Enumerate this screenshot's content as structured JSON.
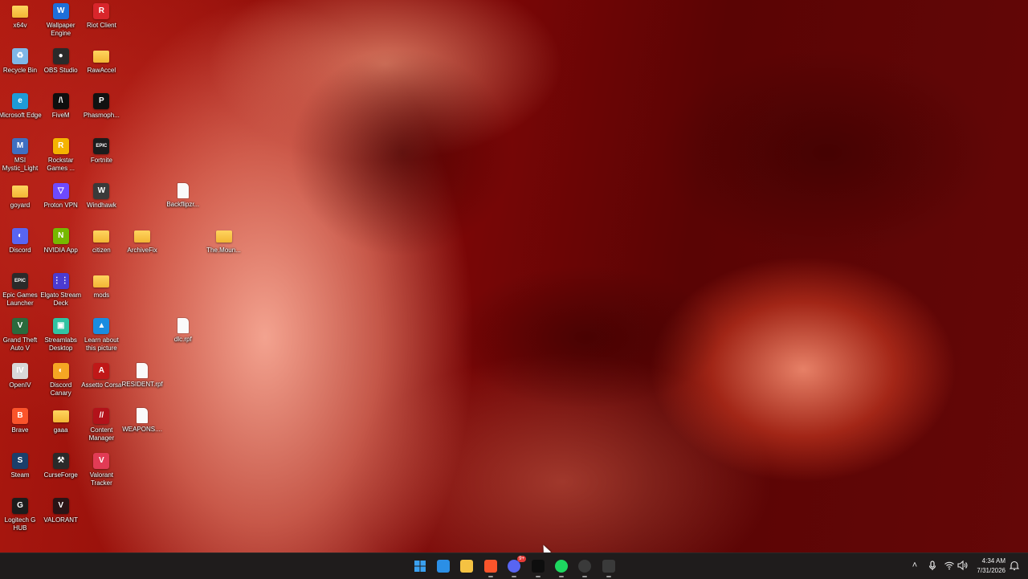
{
  "desktop": {
    "icons": [
      {
        "label": "x64v",
        "icon": "folder-icon"
      },
      {
        "label": "Wallpaper Engine",
        "icon": "wallpaper-engine-icon",
        "color": "#1e6fd9",
        "glyph": "W"
      },
      {
        "label": "Riot Client",
        "icon": "riot-client-icon",
        "color": "#d9262b",
        "glyph": "R"
      },
      {
        "label": "Recycle Bin",
        "icon": "recycle-bin-icon",
        "color": "#7fb7e8",
        "glyph": "♻"
      },
      {
        "label": "OBS Studio",
        "icon": "obs-studio-icon",
        "color": "#2a2a2a",
        "glyph": "●"
      },
      {
        "label": "RawAccel",
        "icon": "folder-icon"
      },
      {
        "label": "Microsoft Edge",
        "icon": "edge-icon",
        "color": "#1f9bd6",
        "glyph": "e"
      },
      {
        "label": "FiveM",
        "icon": "fivem-icon",
        "color": "#0e0e0e",
        "glyph": "/\\"
      },
      {
        "label": "Phasmoph...",
        "icon": "phasmophobia-icon",
        "color": "#111111",
        "glyph": "P"
      },
      {
        "label": "MSI Mystic_Light",
        "icon": "msi-mystic-light-icon",
        "color": "#3f6fc2",
        "glyph": "M"
      },
      {
        "label": "Rockstar Games ...",
        "icon": "rockstar-games-icon",
        "color": "#f5b400",
        "glyph": "R"
      },
      {
        "label": "Fortnite",
        "icon": "fortnite-icon",
        "color": "#1c1c1c",
        "glyph": "EPIC"
      },
      {
        "label": "goyard",
        "icon": "folder-icon"
      },
      {
        "label": "Proton VPN",
        "icon": "proton-vpn-icon",
        "color": "#6d4aff",
        "glyph": "▽"
      },
      {
        "label": "Windhawk",
        "icon": "windhawk-icon",
        "color": "#3a3a3a",
        "glyph": "W"
      },
      {
        "label": "Backflipzr...",
        "icon": "file-icon"
      },
      {
        "label": "Discord",
        "icon": "discord-icon",
        "color": "#5865f2",
        "glyph": "◐"
      },
      {
        "label": "NVIDIA App",
        "icon": "nvidia-app-icon",
        "color": "#76b900",
        "glyph": "N"
      },
      {
        "label": "citizen",
        "icon": "folder-icon"
      },
      {
        "label": "ArchiveFix",
        "icon": "folder-icon"
      },
      {
        "label": "The.Moun...",
        "icon": "archive-folder-icon"
      },
      {
        "label": "Epic Games Launcher",
        "icon": "epic-games-icon",
        "color": "#2a2a2a",
        "glyph": "EPIC"
      },
      {
        "label": "Elgato Stream Deck",
        "icon": "stream-deck-icon",
        "color": "#4b3bd1",
        "glyph": "⋮⋮"
      },
      {
        "label": "mods",
        "icon": "folder-icon"
      },
      {
        "label": "Grand Theft Auto V",
        "icon": "gta-v-icon",
        "color": "#2b6a3d",
        "glyph": "V"
      },
      {
        "label": "Streamlabs Desktop",
        "icon": "streamlabs-icon",
        "color": "#31c3a2",
        "glyph": "▣"
      },
      {
        "label": "Learn about this picture",
        "icon": "learn-about-picture-icon",
        "color": "#1a8ce0",
        "glyph": "▲"
      },
      {
        "label": "dlc.rpf",
        "icon": "file-icon"
      },
      {
        "label": "OpenIV",
        "icon": "openiv-icon",
        "color": "#d8d8d8",
        "glyph": "IV"
      },
      {
        "label": "Discord Canary",
        "icon": "discord-canary-icon",
        "color": "#f5a623",
        "glyph": "◐"
      },
      {
        "label": "Assetto Corsa",
        "icon": "assetto-corsa-icon",
        "color": "#c01818",
        "glyph": "A"
      },
      {
        "label": "RESIDENT.rpf",
        "icon": "file-icon"
      },
      {
        "label": "Brave",
        "icon": "brave-icon",
        "color": "#fb542b",
        "glyph": "B"
      },
      {
        "label": "gaaa",
        "icon": "folder-icon"
      },
      {
        "label": "Content Manager",
        "icon": "content-manager-icon",
        "color": "#b3121a",
        "glyph": "//"
      },
      {
        "label": "WEAPONS....",
        "icon": "file-icon"
      },
      {
        "label": "Steam",
        "icon": "steam-icon",
        "color": "#1b3f6b",
        "glyph": "S"
      },
      {
        "label": "CurseForge",
        "icon": "curseforge-icon",
        "color": "#2a2a2a",
        "glyph": "⚒"
      },
      {
        "label": "Valorant Tracker",
        "icon": "valorant-tracker-icon",
        "color": "#e23b55",
        "glyph": "V"
      },
      {
        "label": "Logitech G HUB",
        "icon": "logitech-g-hub-icon",
        "color": "#1c1c1c",
        "glyph": "G"
      },
      {
        "label": "VALORANT",
        "icon": "valorant-icon",
        "color": "#2a1416",
        "glyph": "V"
      }
    ]
  },
  "taskbar": {
    "apps": [
      {
        "name": "start-button",
        "icon": "windows-start-icon",
        "color": "#3aa0f0"
      },
      {
        "name": "taskbar-microsoft-store",
        "icon": "microsoft-store-icon",
        "color": "#2b8fe6"
      },
      {
        "name": "taskbar-file-explorer",
        "icon": "file-explorer-icon",
        "color": "#f5c242"
      },
      {
        "name": "taskbar-brave",
        "icon": "brave-icon",
        "color": "#fb542b",
        "running": true
      },
      {
        "name": "taskbar-discord",
        "icon": "discord-icon",
        "color": "#5865f2",
        "running": true,
        "badge": "9+"
      },
      {
        "name": "taskbar-fivem",
        "icon": "fivem-icon",
        "color": "#0e0e0e",
        "running": true
      },
      {
        "name": "taskbar-spotify",
        "icon": "spotify-icon",
        "color": "#1ed760",
        "running": true
      },
      {
        "name": "taskbar-chrome",
        "icon": "chrome-icon",
        "color": "#3a3a3a",
        "running": true
      },
      {
        "name": "taskbar-windhawk",
        "icon": "windhawk-icon",
        "color": "#3a3a3a",
        "running": true
      }
    ],
    "tray": {
      "time": "4:34 AM",
      "date": "7/31/2026"
    }
  }
}
